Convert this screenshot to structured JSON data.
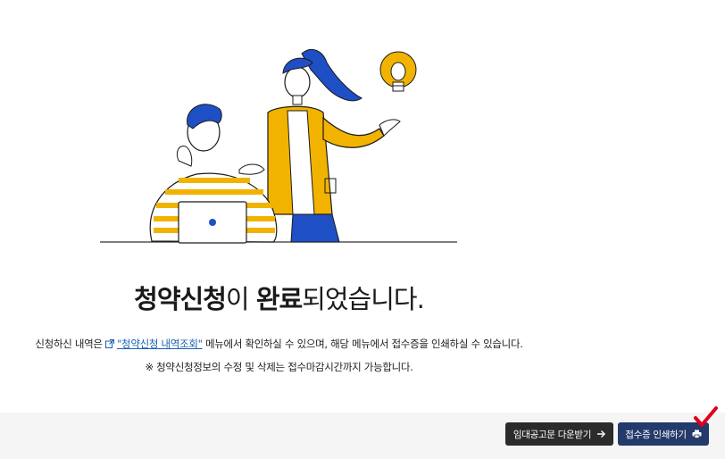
{
  "headline": {
    "part1": "청약신청",
    "part2": "이 ",
    "part3": "완료",
    "part4": "되었습니다."
  },
  "description": {
    "prefix": "신청하신 내역은 ",
    "link": "\"청약신청 내역조회\"",
    "suffix": " 메뉴에서 확인하실 수 있으며, 해당 메뉴에서 접수증을 인쇄하실 수 있습니다."
  },
  "note": "※ 청약신청정보의 수정 및 삭제는 접수마감시간까지 가능합니다.",
  "footer": {
    "download_label": "임대공고문 다운받기",
    "print_label": "접수증 인쇄하기"
  },
  "icons": {
    "external_link": "external-link-icon",
    "arrow": "arrow-right-icon",
    "print": "printer-icon",
    "check": "check-mark-icon"
  },
  "colors": {
    "link": "#1a5fb4",
    "download_button": "#2b2b2b",
    "print_button": "#233a6b",
    "check_mark": "#e0001a",
    "illustration_yellow": "#f2b300",
    "illustration_blue": "#1f4fc4"
  }
}
